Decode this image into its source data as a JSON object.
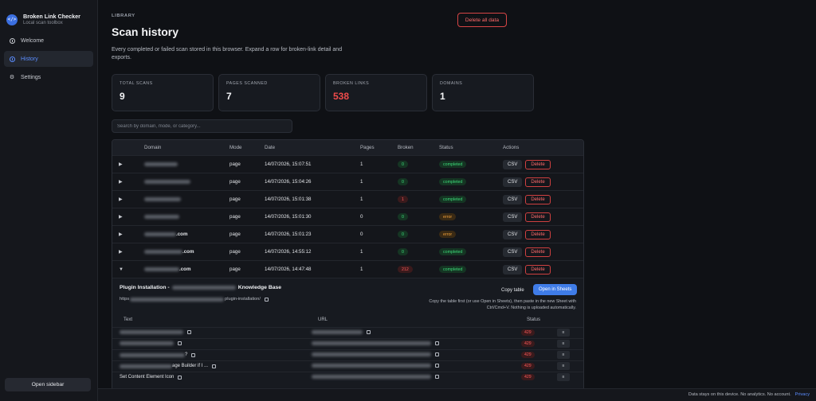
{
  "sidebar": {
    "brand_title": "Broken Link Checker",
    "brand_subtitle": "Local scan toolbox",
    "items": [
      {
        "label": "Welcome",
        "icon": "info-icon"
      },
      {
        "label": "History",
        "icon": "clock-icon",
        "active": true
      },
      {
        "label": "Settings",
        "icon": "gear-icon"
      }
    ],
    "open_sidebar_label": "Open sidebar"
  },
  "header": {
    "eyebrow": "LIBRARY",
    "title": "Scan history",
    "description": "Every completed or failed scan stored in this browser. Expand a row for broken-link detail and exports.",
    "delete_all_label": "Delete all data"
  },
  "stats": [
    {
      "label": "TOTAL SCANS",
      "value": "9"
    },
    {
      "label": "PAGES SCANNED",
      "value": "7"
    },
    {
      "label": "BROKEN LINKS",
      "value": "538",
      "color": "#ef4b4b"
    },
    {
      "label": "DOMAINS",
      "value": "1"
    }
  ],
  "search": {
    "placeholder": "Search by domain, mode, or category..."
  },
  "table": {
    "headers": {
      "domain": "Domain",
      "mode": "Mode",
      "date": "Date",
      "pages": "Pages",
      "broken": "Broken",
      "status": "Status",
      "actions": "Actions"
    },
    "csv_label": "CSV",
    "delete_label": "Delete",
    "rows": [
      {
        "arrow": "▶",
        "domain_suffix": "",
        "mode": "page",
        "date": "14/07/2026, 15:07:51",
        "pages": "1",
        "broken": "0",
        "status": "completed"
      },
      {
        "arrow": "▶",
        "domain_suffix": "",
        "mode": "page",
        "date": "14/07/2026, 15:04:26",
        "pages": "1",
        "broken": "0",
        "status": "completed"
      },
      {
        "arrow": "▶",
        "domain_suffix": "",
        "mode": "page",
        "date": "14/07/2026, 15:01:38",
        "pages": "1",
        "broken": "1",
        "status": "completed"
      },
      {
        "arrow": "▶",
        "domain_suffix": "",
        "mode": "page",
        "date": "14/07/2026, 15:01:30",
        "pages": "0",
        "broken": "0",
        "status": "error"
      },
      {
        "arrow": "▶",
        "domain_suffix": ".com",
        "mode": "page",
        "date": "14/07/2026, 15:01:23",
        "pages": "0",
        "broken": "0",
        "status": "error"
      },
      {
        "arrow": "▶",
        "domain_suffix": ".com",
        "mode": "page",
        "date": "14/07/2026, 14:55:12",
        "pages": "1",
        "broken": "0",
        "status": "completed"
      },
      {
        "arrow": "▼",
        "domain_suffix": ".com",
        "mode": "page",
        "date": "14/07/2026, 14:47:48",
        "pages": "1",
        "broken": "212",
        "status": "completed"
      }
    ]
  },
  "expanded": {
    "title_prefix": "Plugin Installation - ",
    "title_suffix": "Knowledge Base",
    "url_prefix": "https",
    "url_suffix": "plugin-installation/",
    "copy_table_label": "Copy table",
    "open_sheets_label": "Open in Sheets",
    "help_text": "Copy the table first (or use Open in Sheets), then paste in the new Sheet with Ctrl/Cmd+V. Nothing is uploaded automatically.",
    "sub_headers": {
      "text": "Text",
      "url": "URL",
      "status": "Status"
    },
    "menu_glyph": "≡",
    "sub_rows": [
      {
        "text_suffix": "",
        "status": "429"
      },
      {
        "text_suffix": "",
        "status": "429"
      },
      {
        "text_suffix": "?",
        "status": "429"
      },
      {
        "text_suffix": "age Builder if I ...",
        "status": "429"
      },
      {
        "text_suffix": "Set Content Element Icon",
        "status": "429"
      }
    ]
  },
  "footer": {
    "text": "Data stays on this device. No analytics. No account.",
    "privacy_label": "Privacy"
  },
  "colors": {
    "accent": "#5b8dff",
    "danger": "#ef4b4b",
    "success": "#3ddc7a",
    "warning": "#f0a13b",
    "primary_button": "#3f7ce8"
  }
}
